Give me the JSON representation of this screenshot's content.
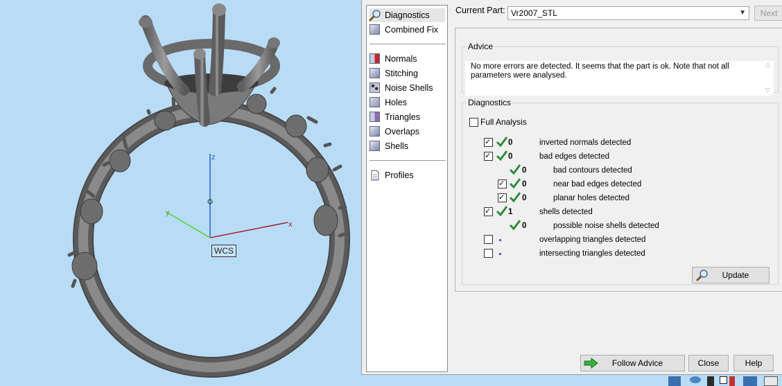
{
  "viewport": {
    "axes": {
      "z": "z",
      "y": "y",
      "x": "x"
    },
    "wcs_label": "WCS"
  },
  "nav": {
    "items": [
      {
        "label": "Diagnostics",
        "icon": "magnifier-icon"
      },
      {
        "label": "Combined Fix",
        "icon": "cube-icon"
      },
      {
        "label": "Normals",
        "icon": "normals-cube-icon"
      },
      {
        "label": "Stitching",
        "icon": "stitching-cube-icon"
      },
      {
        "label": "Noise Shells",
        "icon": "noise-shells-cube-icon"
      },
      {
        "label": "Holes",
        "icon": "holes-cube-icon"
      },
      {
        "label": "Triangles",
        "icon": "triangles-cube-icon"
      },
      {
        "label": "Overlaps",
        "icon": "overlaps-cube-icon"
      },
      {
        "label": "Shells",
        "icon": "shells-cube-icon"
      },
      {
        "label": "Profiles",
        "icon": "document-icon"
      }
    ]
  },
  "header": {
    "current_part_label": "Current Part:",
    "current_part_value": "Vr2007_STL",
    "next_label": "Next"
  },
  "advice": {
    "title": "Advice",
    "text": "No more errors are detected. It seems that the part is ok. Note that not all parameters were analysed."
  },
  "diagnostics": {
    "title": "Diagnostics",
    "full_analysis_label": "Full Analysis",
    "rows": [
      {
        "checked": true,
        "status": "ok",
        "count": "0",
        "label": "inverted normals detected"
      },
      {
        "checked": true,
        "status": "ok",
        "count": "0",
        "label": "bad edges detected"
      },
      {
        "checked": null,
        "status": "ok",
        "count": "0",
        "label": "bad contours detected"
      },
      {
        "checked": true,
        "status": "ok",
        "count": "0",
        "label": "near bad edges detected"
      },
      {
        "checked": true,
        "status": "ok",
        "count": "0",
        "label": "planar holes detected"
      },
      {
        "checked": true,
        "status": "ok",
        "count": "1",
        "label": "shells detected"
      },
      {
        "checked": null,
        "status": "ok",
        "count": "0",
        "label": "possible noise shells detected"
      },
      {
        "checked": false,
        "status": "not-analysed",
        "count": "",
        "label": "overlapping triangles detected"
      },
      {
        "checked": false,
        "status": "not-analysed",
        "count": "",
        "label": "intersecting triangles detected"
      }
    ],
    "update_label": "Update"
  },
  "footer": {
    "follow_advice_label": "Follow Advice",
    "close_label": "Close",
    "help_label": "Help"
  },
  "colors": {
    "viewport_bg": "#b9dcf6",
    "ok_green": "#2e8b3a",
    "axis_x": "#a3232a",
    "axis_y": "#55d030",
    "axis_z": "#2a5fc4"
  }
}
